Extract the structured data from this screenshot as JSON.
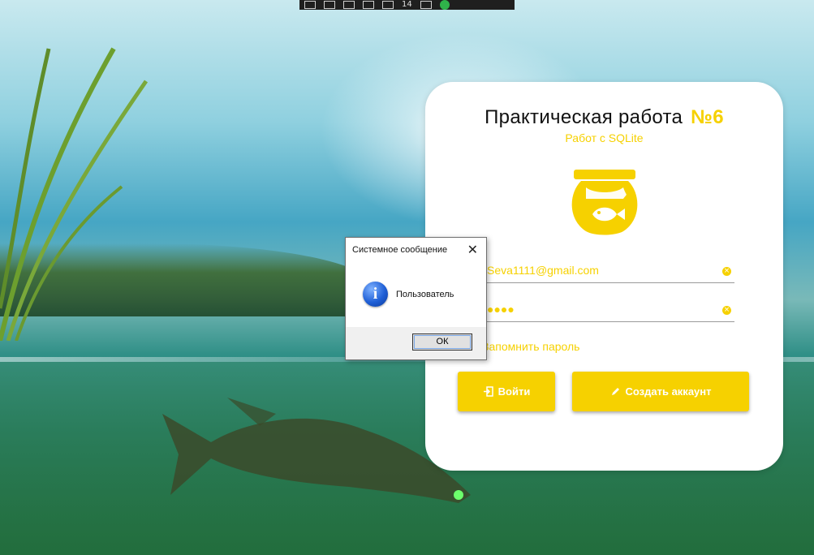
{
  "toolbar": {
    "counter_text": "14"
  },
  "login": {
    "title": "Практическая работа",
    "title_number": "№6",
    "subtitle": "Работ с SQLite",
    "email_value": "Seva1111@gmail.com",
    "password_value": "●●●●",
    "remember_label": "Запомнить пароль",
    "login_button": "Войти",
    "create_button": "Создать аккаунт",
    "accent_color": "#f6d100"
  },
  "dialog": {
    "title": "Системное сообщение",
    "message": "Пользователь",
    "ok_label": "ОК",
    "close_glyph": "✕",
    "icon": "info-icon",
    "icon_glyph": "i"
  }
}
